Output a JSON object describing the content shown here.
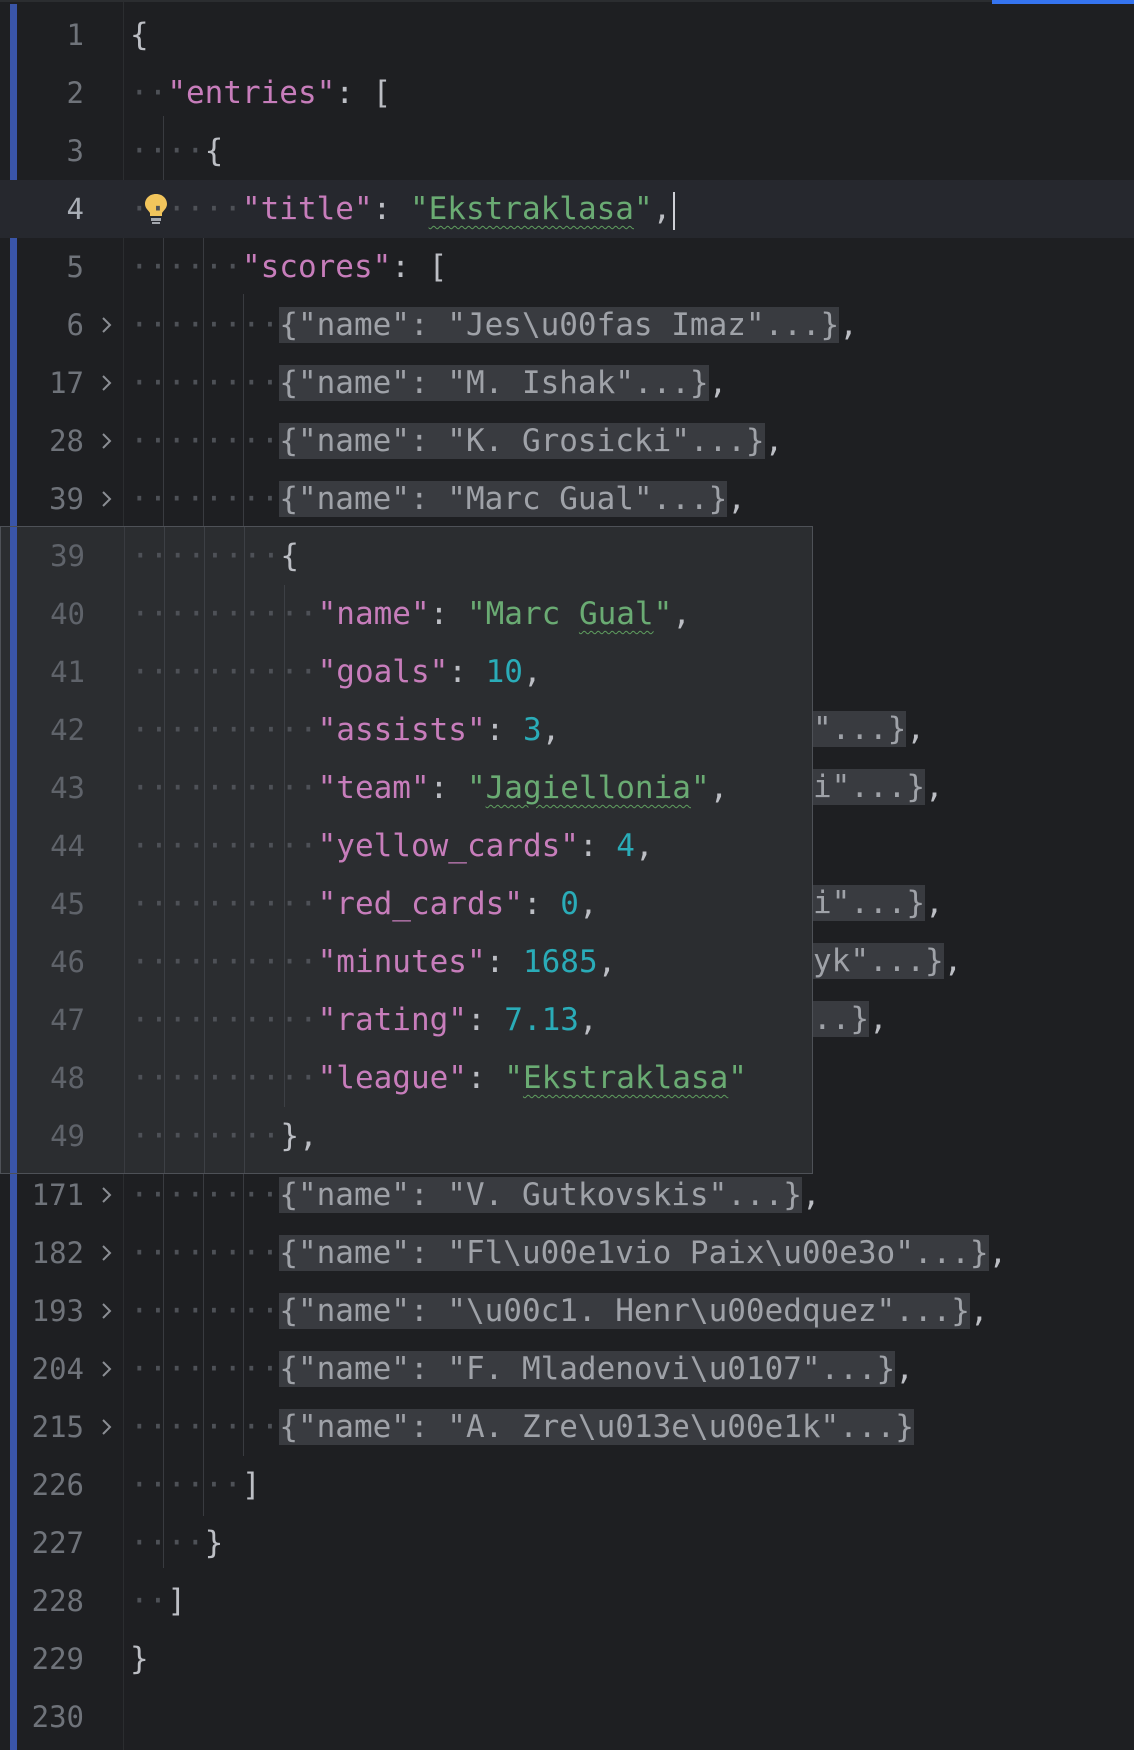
{
  "editor": {
    "lines": [
      {
        "num": "1",
        "segs": [
          {
            "t": "{",
            "c": "p"
          }
        ]
      },
      {
        "num": "2",
        "segs": [
          {
            "t": "\"entries\"",
            "c": "k"
          },
          {
            "t": ": [",
            "c": "p"
          }
        ]
      },
      {
        "num": "3",
        "segs": [
          {
            "t": "{",
            "c": "p"
          }
        ]
      },
      {
        "num": "4",
        "segs": [
          {
            "t": "\"title\"",
            "c": "k"
          },
          {
            "t": ": ",
            "c": "p"
          },
          {
            "t": "\"",
            "c": "s"
          },
          {
            "t": "Ekstraklasa",
            "c": "s sq"
          },
          {
            "t": "\"",
            "c": "s"
          },
          {
            "t": ",",
            "c": "p"
          }
        ]
      },
      {
        "num": "5",
        "segs": [
          {
            "t": "\"scores\"",
            "c": "k"
          },
          {
            "t": ": [",
            "c": "p"
          }
        ]
      },
      {
        "num": "6",
        "segs": [
          {
            "t": "{\"name\": \"Jes\\u00fas Imaz\"...}",
            "c": "collapsed"
          },
          {
            "t": ",",
            "c": "p"
          }
        ]
      },
      {
        "num": "17",
        "segs": [
          {
            "t": "{\"name\": \"M. Ishak\"...}",
            "c": "collapsed"
          },
          {
            "t": ",",
            "c": "p"
          }
        ]
      },
      {
        "num": "28",
        "segs": [
          {
            "t": "{\"name\": \"K. Grosicki\"...}",
            "c": "collapsed"
          },
          {
            "t": ",",
            "c": "p"
          }
        ]
      },
      {
        "num": "39",
        "segs": [
          {
            "t": "{\"name\": \"Marc Gual\"...}",
            "c": "collapsed"
          },
          {
            "t": ",",
            "c": "p"
          }
        ]
      },
      {
        "num": "171",
        "segs": [
          {
            "t": "{\"name\": \"V. Gutkovskis\"...}",
            "c": "collapsed"
          },
          {
            "t": ",",
            "c": "p"
          }
        ]
      },
      {
        "num": "182",
        "segs": [
          {
            "t": "{\"name\": \"Fl\\u00e1vio Paix\\u00e3o\"...}",
            "c": "collapsed"
          },
          {
            "t": ",",
            "c": "p"
          }
        ]
      },
      {
        "num": "193",
        "segs": [
          {
            "t": "{\"name\": \"\\u00c1. Henr\\u00edquez\"...}",
            "c": "collapsed"
          },
          {
            "t": ",",
            "c": "p"
          }
        ]
      },
      {
        "num": "204",
        "segs": [
          {
            "t": "{\"name\": \"F. Mladenovi\\u0107\"...}",
            "c": "collapsed"
          },
          {
            "t": ",",
            "c": "p"
          }
        ]
      },
      {
        "num": "215",
        "segs": [
          {
            "t": "{\"name\": \"A. Zre\\u013e\\u00e1k\"...}",
            "c": "collapsed"
          }
        ]
      },
      {
        "num": "226",
        "segs": [
          {
            "t": "]",
            "c": "p"
          }
        ]
      },
      {
        "num": "227",
        "segs": [
          {
            "t": "}",
            "c": "p"
          }
        ]
      },
      {
        "num": "228",
        "segs": [
          {
            "t": "]",
            "c": "p"
          }
        ]
      },
      {
        "num": "229",
        "segs": [
          {
            "t": "}",
            "c": "p"
          }
        ]
      },
      {
        "num": "230",
        "segs": []
      }
    ],
    "partial_rows": [
      {
        "segs": [
          {
            "t": "\"...}",
            "c": "collapsed"
          },
          {
            "t": ",",
            "c": "p"
          }
        ]
      },
      {
        "segs": [
          {
            "t": "i\"...}",
            "c": "collapsed"
          },
          {
            "t": ",",
            "c": "p"
          }
        ]
      },
      {
        "segs": [
          {
            "t": "i\"...}",
            "c": "collapsed"
          },
          {
            "t": ",",
            "c": "p"
          }
        ]
      },
      {
        "segs": [
          {
            "t": "yk\"...}",
            "c": "collapsed"
          },
          {
            "t": ",",
            "c": "p"
          }
        ]
      },
      {
        "segs": [
          {
            "t": "..}",
            "c": "collapsed"
          },
          {
            "t": ",",
            "c": "p"
          }
        ]
      }
    ]
  },
  "popup": {
    "lines": [
      {
        "num": "39",
        "segs": [
          {
            "t": "{",
            "c": "p"
          }
        ]
      },
      {
        "num": "40",
        "segs": [
          {
            "t": "\"name\"",
            "c": "k"
          },
          {
            "t": ": ",
            "c": "p"
          },
          {
            "t": "\"Marc ",
            "c": "s"
          },
          {
            "t": "Gual",
            "c": "s sq"
          },
          {
            "t": "\"",
            "c": "s"
          },
          {
            "t": ",",
            "c": "p"
          }
        ]
      },
      {
        "num": "41",
        "segs": [
          {
            "t": "\"goals\"",
            "c": "k"
          },
          {
            "t": ": ",
            "c": "p"
          },
          {
            "t": "10",
            "c": "n"
          },
          {
            "t": ",",
            "c": "p"
          }
        ]
      },
      {
        "num": "42",
        "segs": [
          {
            "t": "\"assists\"",
            "c": "k"
          },
          {
            "t": ": ",
            "c": "p"
          },
          {
            "t": "3",
            "c": "n"
          },
          {
            "t": ",",
            "c": "p"
          }
        ]
      },
      {
        "num": "43",
        "segs": [
          {
            "t": "\"team\"",
            "c": "k"
          },
          {
            "t": ": ",
            "c": "p"
          },
          {
            "t": "\"",
            "c": "s"
          },
          {
            "t": "Jagiellonia",
            "c": "s sq"
          },
          {
            "t": "\"",
            "c": "s"
          },
          {
            "t": ",",
            "c": "p"
          }
        ]
      },
      {
        "num": "44",
        "segs": [
          {
            "t": "\"yellow_cards\"",
            "c": "k"
          },
          {
            "t": ": ",
            "c": "p"
          },
          {
            "t": "4",
            "c": "n"
          },
          {
            "t": ",",
            "c": "p"
          }
        ]
      },
      {
        "num": "45",
        "segs": [
          {
            "t": "\"red_cards\"",
            "c": "k"
          },
          {
            "t": ": ",
            "c": "p"
          },
          {
            "t": "0",
            "c": "n"
          },
          {
            "t": ",",
            "c": "p"
          }
        ]
      },
      {
        "num": "46",
        "segs": [
          {
            "t": "\"minutes\"",
            "c": "k"
          },
          {
            "t": ": ",
            "c": "p"
          },
          {
            "t": "1685",
            "c": "n"
          },
          {
            "t": ",",
            "c": "p"
          }
        ]
      },
      {
        "num": "47",
        "segs": [
          {
            "t": "\"rating\"",
            "c": "k"
          },
          {
            "t": ": ",
            "c": "p"
          },
          {
            "t": "7.13",
            "c": "n"
          },
          {
            "t": ",",
            "c": "p"
          }
        ]
      },
      {
        "num": "48",
        "segs": [
          {
            "t": "\"league\"",
            "c": "k"
          },
          {
            "t": ": ",
            "c": "p"
          },
          {
            "t": "\"",
            "c": "s"
          },
          {
            "t": "Ekstraklasa",
            "c": "s sq"
          },
          {
            "t": "\"",
            "c": "s"
          }
        ]
      },
      {
        "num": "49",
        "segs": [
          {
            "t": "}",
            "c": "p"
          },
          {
            "t": ",",
            "c": "p"
          }
        ]
      }
    ]
  },
  "colors": {
    "background": "#1e1f22",
    "popup_background": "#2b2d30",
    "key": "#c77dbb",
    "string": "#6aab73",
    "number": "#2aacb8",
    "punctuation": "#bcbec4",
    "line_number": "#6f737a",
    "collapsed_bg": "#393b40",
    "gutter_bar": "#3a55a8",
    "accent": "#3574f0"
  },
  "icons": {
    "fold": "chevron-right-icon",
    "intention": "lightbulb-icon"
  }
}
